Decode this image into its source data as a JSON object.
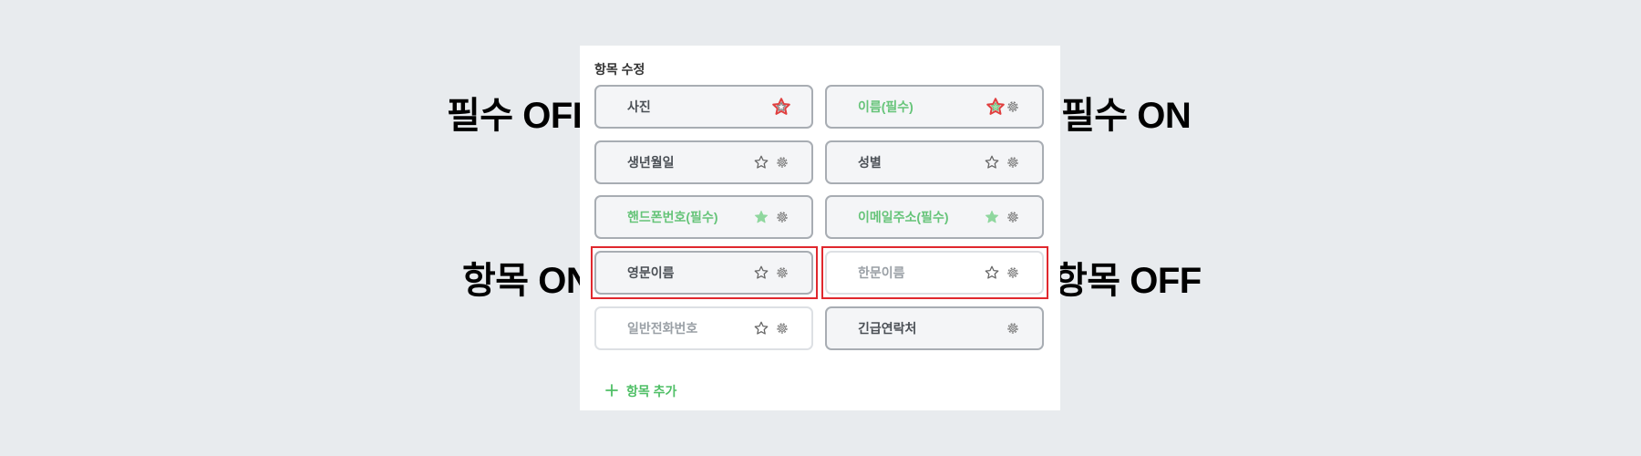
{
  "panel": {
    "title": "항목 수정",
    "add_label": "항목 추가"
  },
  "colors": {
    "required_green": "#66c479",
    "highlight_red": "#e0282e",
    "star_outline_red": "#e04040",
    "background": "#e8ebee"
  },
  "items": [
    {
      "label": "사진",
      "required": false,
      "enabled": true,
      "star": "outline-highlighted",
      "gear": false
    },
    {
      "label": "이름(필수)",
      "required": true,
      "enabled": true,
      "star": "filled-highlighted",
      "gear": true
    },
    {
      "label": "생년월일",
      "required": false,
      "enabled": true,
      "star": "outline",
      "gear": true
    },
    {
      "label": "성별",
      "required": false,
      "enabled": true,
      "star": "outline",
      "gear": true
    },
    {
      "label": "핸드폰번호(필수)",
      "required": true,
      "enabled": true,
      "star": "filled",
      "gear": true
    },
    {
      "label": "이메일주소(필수)",
      "required": true,
      "enabled": true,
      "star": "filled",
      "gear": true
    },
    {
      "label": "영문이름",
      "required": false,
      "enabled": true,
      "star": "outline",
      "gear": true
    },
    {
      "label": "한문이름",
      "required": false,
      "enabled": false,
      "star": "outline",
      "gear": true
    },
    {
      "label": "일반전화번호",
      "required": false,
      "enabled": false,
      "star": "outline",
      "gear": true
    },
    {
      "label": "긴급연락처",
      "required": false,
      "enabled": true,
      "star": "none",
      "gear": true
    }
  ],
  "annotations": {
    "required_off": "필수 OFF",
    "required_on": "필수 ON",
    "item_on": "항목 ON",
    "item_off": "항목 OFF"
  }
}
